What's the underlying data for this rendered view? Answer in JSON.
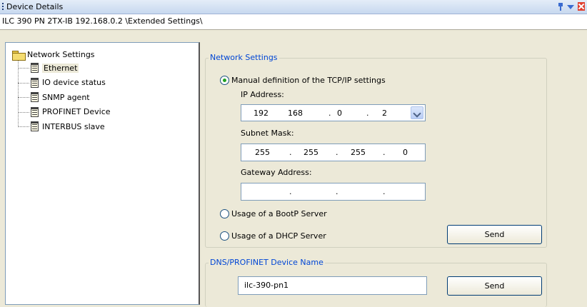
{
  "window": {
    "title": "Device Details"
  },
  "path": "ILC 390 PN 2TX-IB 192.168.0.2 \\Extended Settings\\",
  "tree": {
    "root": "Network Settings",
    "items": [
      {
        "label": "Ethernet",
        "selected": true
      },
      {
        "label": "IO device status"
      },
      {
        "label": "SNMP agent"
      },
      {
        "label": "PROFINET Device"
      },
      {
        "label": "INTERBUS slave"
      }
    ]
  },
  "network": {
    "group_title": "Network Settings",
    "manual_label": "Manual definition of the TCP/IP settings",
    "selected_mode": "manual",
    "ip_label": "IP Address:",
    "ip": [
      "192",
      "168",
      "0",
      "2"
    ],
    "subnet_label": "Subnet Mask:",
    "subnet": [
      "255",
      "255",
      "255",
      "0"
    ],
    "gateway_label": "Gateway Address:",
    "gateway": [
      "",
      "",
      "",
      ""
    ],
    "bootp_label": "Usage of a BootP Server",
    "dhcp_label": "Usage of a DHCP Server",
    "send_label": "Send"
  },
  "dns": {
    "group_title": "DNS/PROFINET Device Name",
    "value": "ilc-390-pn1",
    "send_label": "Send"
  },
  "colors": {
    "group_title": "#0046d5",
    "radio_dot": "#21a121"
  }
}
